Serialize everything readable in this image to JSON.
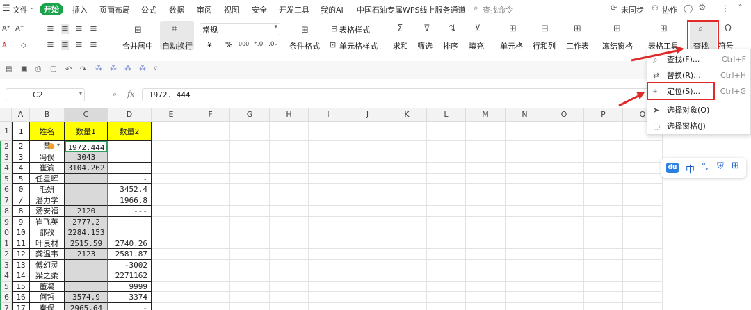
{
  "menu": {
    "file_label": "文件",
    "start_label": "开始",
    "items": [
      "插入",
      "页面布局",
      "公式",
      "数据",
      "审阅",
      "视图",
      "安全",
      "开发工具",
      "我的AI",
      "中国石油专属WPS线上服务通道"
    ],
    "search_label": "查找命令",
    "sync_label": "未同步",
    "collab_label": "协作"
  },
  "ribbon": {
    "merge_label": "合并居中",
    "wrap_label": "自动换行",
    "format_value": "常规",
    "table_style_label": "表格样式",
    "cond_format_label": "条件格式",
    "cell_style_label": "单元格样式",
    "sum_label": "求和",
    "filter_label": "筛选",
    "sort_label": "排序",
    "fill_label": "填充",
    "cell_label": "单元格",
    "rowcol_label": "行和列",
    "sheet_label": "工作表",
    "freeze_label": "冻结窗格",
    "tabletool_label": "表格工具",
    "find_label": "查找",
    "symbol_label": "符号",
    "currency": "¥",
    "percent": "%",
    "thousands": "000",
    "dec_inc": "⁺.0",
    "dec_dec": ".0₋"
  },
  "formula": {
    "cell_ref": "C2",
    "fx": "fx",
    "value": "1972. 444"
  },
  "grid": {
    "columns": [
      "A",
      "B",
      "C",
      "D",
      "E",
      "F",
      "G",
      "H",
      "I",
      "J",
      "K",
      "L",
      "M",
      "N",
      "O",
      "P",
      "Q"
    ],
    "row_headers": [
      "1",
      "2",
      "3",
      "4",
      "5",
      "6",
      "7",
      "8",
      "9",
      "0",
      "1",
      "2",
      "3",
      "4",
      "5",
      "6",
      "7"
    ],
    "rows": [
      [
        "1",
        "姓名",
        "数量1",
        "数量2"
      ],
      [
        "2",
        "黄",
        "1972.444",
        ""
      ],
      [
        "3",
        "冯俣",
        "3043",
        ""
      ],
      [
        "4",
        "崔渝",
        "3104.262",
        ""
      ],
      [
        "5",
        "任星晖",
        "",
        "-"
      ],
      [
        "0",
        "毛妍",
        "",
        "3452.4"
      ],
      [
        "/",
        "潘力学",
        "",
        "1966.8"
      ],
      [
        "8",
        "汤安福",
        "2120",
        "---"
      ],
      [
        "9",
        "崔飞英",
        "2777.2",
        ""
      ],
      [
        "10",
        "邵孜",
        "2284.153",
        ""
      ],
      [
        "11",
        "叶良材",
        "2515.59",
        "2740.26"
      ],
      [
        "12",
        "龚温韦",
        "2123",
        "2581.87"
      ],
      [
        "13",
        "傅幻灵",
        "",
        "-3002"
      ],
      [
        "14",
        "梁之柔",
        "",
        "2271162"
      ],
      [
        "15",
        "董凝",
        "",
        "9999"
      ],
      [
        "16",
        "何哲",
        "3574.9",
        "3374"
      ],
      [
        "17",
        "秦俣",
        "2965.64",
        "-"
      ]
    ]
  },
  "dropdown": {
    "items": [
      {
        "label": "查找(F)...",
        "shortcut": "Ctrl+F"
      },
      {
        "label": "替换(R)...",
        "shortcut": "Ctrl+H"
      },
      {
        "label": "定位(S)...",
        "shortcut": "Ctrl+G"
      },
      {
        "label": "选择对象(O)",
        "shortcut": ""
      },
      {
        "label": "选择窗格(J)",
        "shortcut": ""
      }
    ]
  },
  "float_bar": {
    "badge": "du",
    "lang": "中",
    "punct": "°,"
  },
  "colors": {
    "header_fill": "#ffff00",
    "selection": "#d9d9d9",
    "selection_border": "#2e9f5d",
    "highlight_red": "#e02a2a",
    "start_green": "#1aa34a"
  }
}
